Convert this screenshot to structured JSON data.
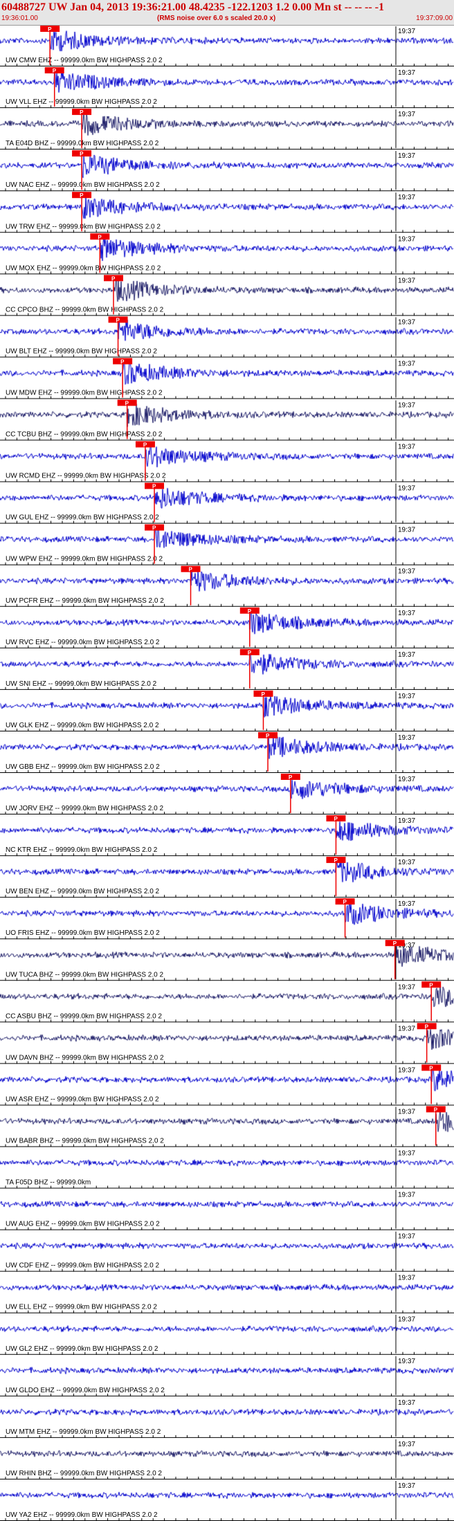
{
  "header": {
    "title": "60488727 UW Jan 04, 2013 19:36:21.00   48.4235 -122.1203  1.2 0.00 Mn st -- -- --  -1",
    "start_time": "19:36:01.00",
    "note": "(RMS noise over 6.0 s scaled 20.0 x)",
    "end_time": "19:37:09.00"
  },
  "colors": {
    "trace_blue": "#0000cc",
    "trace_dark": "#1a1a66",
    "pick_red": "#ee0000",
    "header_bg": "#e6e6e6",
    "header_text": "#cc0000"
  },
  "chart_data": {
    "type": "line",
    "x_unit": "time (UTC)",
    "x_range": [
      "19:36:01.00",
      "19:37:09.00"
    ],
    "minute_mark_label": "19:37",
    "pick_label": "P",
    "traces": [
      {
        "label": "UW CMW EHZ -- 99999.0km BW  HIGHPASS  2.0  2",
        "color": "blue",
        "pick": 0.11
      },
      {
        "label": "UW VLL EHZ -- 99999.0km BW  HIGHPASS  2.0  2",
        "color": "blue",
        "pick": 0.12
      },
      {
        "label": "TA E04D BHZ -- 99999.0km BW  HIGHPASS  2.0  2",
        "color": "dark",
        "pick": 0.18
      },
      {
        "label": "UW NAC EHZ -- 99999.0km BW  HIGHPASS  2.0  2",
        "color": "blue",
        "pick": 0.18
      },
      {
        "label": "UW TRW EHZ -- 99999.0km BW  HIGHPASS  2.0  2",
        "color": "blue",
        "pick": 0.18
      },
      {
        "label": "UW MOX EHZ -- 99999.0km BW  HIGHPASS  2.0  2",
        "color": "blue",
        "pick": 0.22
      },
      {
        "label": "CC CPCO BHZ -- 99999.0km BW  HIGHPASS  2.0  2",
        "color": "dark",
        "pick": 0.25
      },
      {
        "label": "UW BLT EHZ -- 99999.0km BW  HIGHPASS  2.0  2",
        "color": "blue",
        "pick": 0.26
      },
      {
        "label": "UW MDW EHZ -- 99999.0km BW  HIGHPASS  2.0  2",
        "color": "blue",
        "pick": 0.27
      },
      {
        "label": "CC TCBU BHZ -- 99999.0km BW  HIGHPASS  2.0  2",
        "color": "dark",
        "pick": 0.28
      },
      {
        "label": "UW RCMD EHZ -- 99999.0km BW  HIGHPASS  2.0  2",
        "color": "blue",
        "pick": 0.32
      },
      {
        "label": "UW GUL EHZ -- 99999.0km BW  HIGHPASS  2.0  2",
        "color": "blue",
        "pick": 0.34
      },
      {
        "label": "UW WPW EHZ -- 99999.0km BW  HIGHPASS  2.0  2",
        "color": "blue",
        "pick": 0.34
      },
      {
        "label": "UW PCFR EHZ -- 99999.0km BW  HIGHPASS  2.0  2",
        "color": "blue",
        "pick": 0.42
      },
      {
        "label": "UW RVC EHZ -- 99999.0km BW  HIGHPASS  2.0  2",
        "color": "blue",
        "pick": 0.55
      },
      {
        "label": "UW SNI EHZ -- 99999.0km BW  HIGHPASS  2.0  2",
        "color": "blue",
        "pick": 0.55
      },
      {
        "label": "UW GLK EHZ -- 99999.0km BW  HIGHPASS  2.0  2",
        "color": "blue",
        "pick": 0.58
      },
      {
        "label": "UW GBB EHZ -- 99999.0km BW  HIGHPASS  2.0  2",
        "color": "blue",
        "pick": 0.59
      },
      {
        "label": "UW JORV EHZ -- 99999.0km BW  HIGHPASS  2.0  2",
        "color": "blue",
        "pick": 0.64
      },
      {
        "label": "NC KTR EHZ -- 99999.0km BW  HIGHPASS  2.0  2",
        "color": "blue",
        "pick": 0.74
      },
      {
        "label": "UW BEN EHZ -- 99999.0km BW  HIGHPASS  2.0  2",
        "color": "blue",
        "pick": 0.74
      },
      {
        "label": "UO FRIS EHZ -- 99999.0km BW  HIGHPASS  2.0  2",
        "color": "blue",
        "pick": 0.76
      },
      {
        "label": "UW TUCA BHZ -- 99999.0km BW  HIGHPASS  2.0  2",
        "color": "dark",
        "pick": 0.87
      },
      {
        "label": "CC ASBU BHZ -- 99999.0km BW  HIGHPASS  2.0  2",
        "color": "dark",
        "pick": 0.95
      },
      {
        "label": "UW DAVN BHZ -- 99999.0km BW  HIGHPASS  2.0  2",
        "color": "dark",
        "pick": 0.94
      },
      {
        "label": "UW ASR EHZ -- 99999.0km BW  HIGHPASS  2.0  2",
        "color": "blue",
        "pick": 0.95
      },
      {
        "label": "UW BABR BHZ -- 99999.0km BW  HIGHPASS  2.0  2",
        "color": "dark",
        "pick": 0.96
      },
      {
        "label": "TA F05D BHZ -- 99999.0km",
        "color": "blue",
        "pick": null
      },
      {
        "label": "UW AUG EHZ -- 99999.0km BW  HIGHPASS  2.0  2",
        "color": "blue",
        "pick": null
      },
      {
        "label": "UW CDF EHZ -- 99999.0km BW  HIGHPASS  2.0  2",
        "color": "blue",
        "pick": null
      },
      {
        "label": "UW ELL EHZ -- 99999.0km BW  HIGHPASS  2.0  2",
        "color": "blue",
        "pick": null
      },
      {
        "label": "UW GL2 EHZ -- 99999.0km BW  HIGHPASS  2.0  2",
        "color": "blue",
        "pick": null
      },
      {
        "label": "UW GLDO EHZ -- 99999.0km BW  HIGHPASS  2.0  2",
        "color": "blue",
        "pick": null
      },
      {
        "label": "UW MTM EHZ -- 99999.0km BW  HIGHPASS  2.0  2",
        "color": "blue",
        "pick": null
      },
      {
        "label": "UW RHIN BHZ -- 99999.0km BW  HIGHPASS  2.0  2",
        "color": "dark",
        "pick": null
      },
      {
        "label": "UW YA2 EHZ -- 99999.0km BW  HIGHPASS  2.0  2",
        "color": "blue",
        "pick": null
      }
    ]
  }
}
